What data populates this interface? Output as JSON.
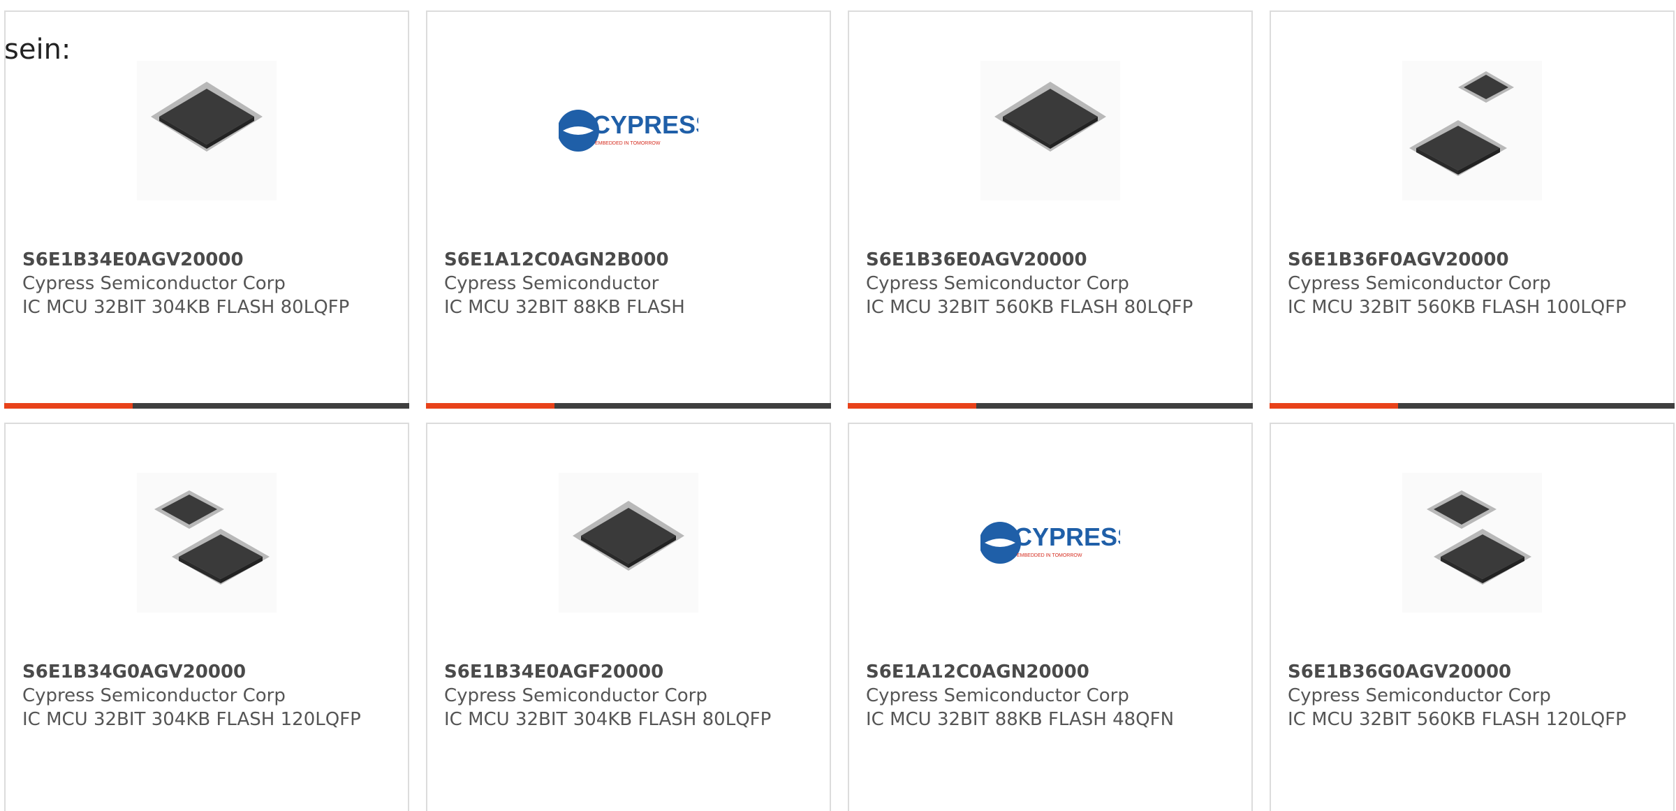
{
  "intro": {
    "text": "sein:"
  },
  "colors": {
    "accent": "#e8421a",
    "bar_dark": "#3f3f3f",
    "chip": "#3a3a3a",
    "cypress_blue": "#1f5fa8",
    "cypress_red": "#d52b1e"
  },
  "cards": [
    {
      "part_number": "S6E1B34E0AGV20000",
      "manufacturer": "Cypress Semiconductor Corp",
      "description": "IC MCU 32BIT 304KB FLASH 80LQFP",
      "image": "chip-single-icon"
    },
    {
      "part_number": "S6E1A12C0AGN2B000",
      "manufacturer": "Cypress Semiconductor",
      "description": "IC MCU 32BIT 88KB FLASH",
      "image": "cypress-logo",
      "logo_text": "CYPRESS",
      "logo_tagline": "EMBEDDED IN TOMORROW"
    },
    {
      "part_number": "S6E1B36E0AGV20000",
      "manufacturer": "Cypress Semiconductor Corp",
      "description": "IC MCU 32BIT 560KB FLASH 80LQFP",
      "image": "chip-single-icon"
    },
    {
      "part_number": "S6E1B36F0AGV20000",
      "manufacturer": "Cypress Semiconductor Corp",
      "description": "IC MCU 32BIT 560KB FLASH 100LQFP",
      "image": "chip-pair-icon"
    },
    {
      "part_number": "S6E1B34G0AGV20000",
      "manufacturer": "Cypress Semiconductor Corp",
      "description": "IC MCU 32BIT 304KB FLASH 120LQFP",
      "image": "chip-pair-icon"
    },
    {
      "part_number": "S6E1B34E0AGF20000",
      "manufacturer": "Cypress Semiconductor Corp",
      "description": "IC MCU 32BIT 304KB FLASH 80LQFP",
      "image": "chip-single-icon"
    },
    {
      "part_number": "S6E1A12C0AGN20000",
      "manufacturer": "Cypress Semiconductor Corp",
      "description": "IC MCU 32BIT 88KB FLASH 48QFN",
      "image": "cypress-logo",
      "logo_text": "CYPRESS",
      "logo_tagline": "EMBEDDED IN TOMORROW"
    },
    {
      "part_number": "S6E1B36G0AGV20000",
      "manufacturer": "Cypress Semiconductor Corp",
      "description": "IC MCU 32BIT 560KB FLASH 120LQFP",
      "image": "chip-pair-icon"
    }
  ]
}
